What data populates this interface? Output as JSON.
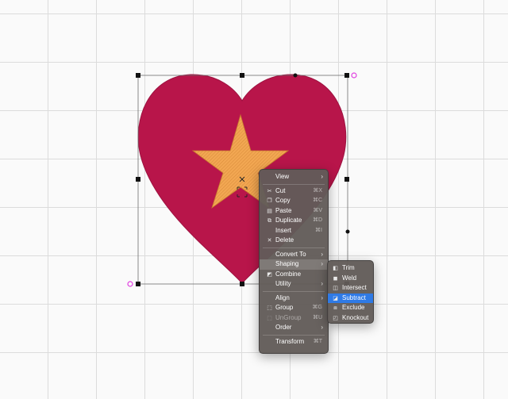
{
  "colors": {
    "heart": "#b8154a",
    "star": "#f0a04e",
    "menu_bg": "#625c58",
    "highlight": "#2f7ae5",
    "handle": "#111111",
    "rotation_handle": "#e040e0"
  },
  "context_menu": {
    "items": [
      {
        "label": "View",
        "icon": "",
        "shortcut": "",
        "submenu": true
      },
      {
        "label": "Cut",
        "icon": "scissors-icon",
        "shortcut": "⌘X"
      },
      {
        "label": "Copy",
        "icon": "copy-icon",
        "shortcut": "⌘C"
      },
      {
        "label": "Paste",
        "icon": "paste-icon",
        "shortcut": "⌘V"
      },
      {
        "label": "Duplicate",
        "icon": "duplicate-icon",
        "shortcut": "⌘D"
      },
      {
        "label": "Insert",
        "icon": "",
        "shortcut": "⌘I"
      },
      {
        "label": "Delete",
        "icon": "delete-icon",
        "shortcut": ""
      },
      {
        "label": "Convert To",
        "icon": "",
        "shortcut": "",
        "submenu": true
      },
      {
        "label": "Shaping",
        "icon": "",
        "shortcut": "",
        "submenu": true,
        "highlighted": true
      },
      {
        "label": "Combine",
        "icon": "combine-icon",
        "shortcut": ""
      },
      {
        "label": "Utility",
        "icon": "",
        "shortcut": "",
        "submenu": true
      },
      {
        "label": "Align",
        "icon": "",
        "shortcut": "",
        "submenu": true
      },
      {
        "label": "Group",
        "icon": "group-icon",
        "shortcut": "⌘G"
      },
      {
        "label": "UnGroup",
        "icon": "ungroup-icon",
        "shortcut": "⌘U",
        "disabled": true
      },
      {
        "label": "Order",
        "icon": "",
        "shortcut": "",
        "submenu": true
      },
      {
        "label": "Transform",
        "icon": "",
        "shortcut": "⌘T"
      }
    ]
  },
  "shaping_submenu": {
    "items": [
      {
        "label": "Trim",
        "icon": "trim-icon"
      },
      {
        "label": "Weld",
        "icon": "weld-icon"
      },
      {
        "label": "Intersect",
        "icon": "intersect-icon"
      },
      {
        "label": "Subtract",
        "icon": "subtract-icon",
        "selected": true
      },
      {
        "label": "Exclude",
        "icon": "exclude-icon"
      },
      {
        "label": "Knockout",
        "icon": "knockout-icon"
      }
    ]
  },
  "submenu_arrow": "›"
}
